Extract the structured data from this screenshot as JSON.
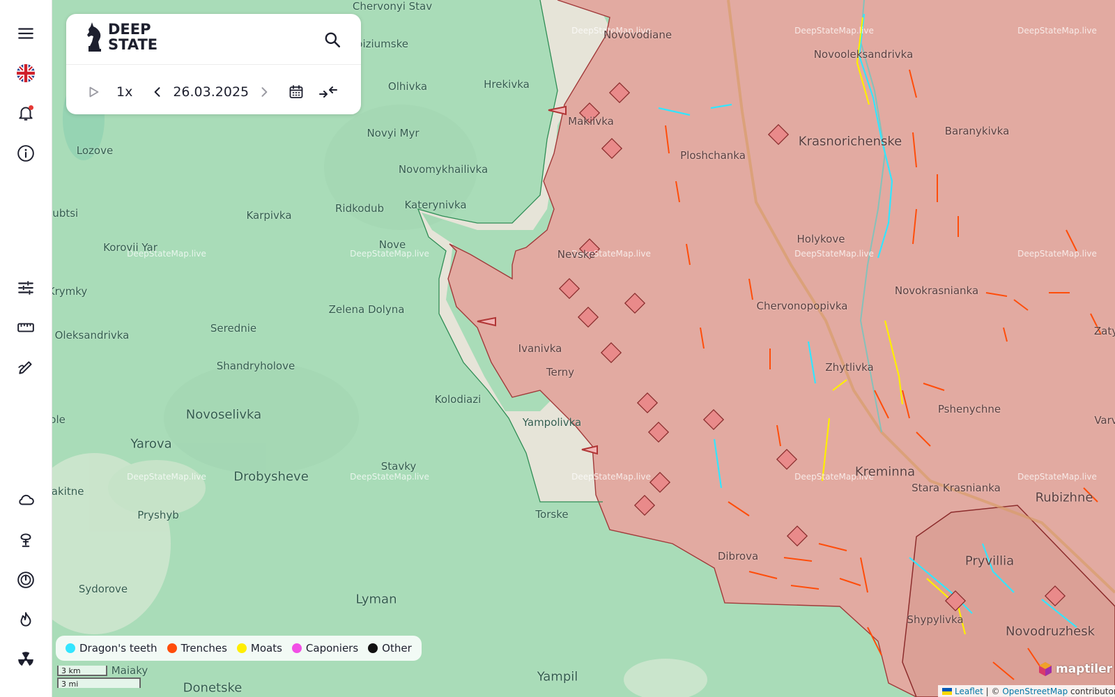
{
  "app": {
    "brand_line1": "DEEP",
    "brand_line2": "STATE",
    "watermark": "DeepStateMap.live"
  },
  "sidebar": {
    "items": [
      {
        "name": "menu",
        "icon": "menu-icon"
      },
      {
        "name": "language",
        "icon": "uk-flag-icon"
      },
      {
        "name": "notifications",
        "icon": "bell-icon"
      },
      {
        "name": "info",
        "icon": "info-icon"
      },
      {
        "name": "filters",
        "icon": "sliders-icon"
      },
      {
        "name": "ruler",
        "icon": "ruler-icon"
      },
      {
        "name": "draw",
        "icon": "draw-icon"
      },
      {
        "name": "weather",
        "icon": "cloud-icon"
      },
      {
        "name": "explosion",
        "icon": "explosion-icon"
      },
      {
        "name": "power",
        "icon": "power-plant-icon"
      },
      {
        "name": "fire",
        "icon": "fire-icon"
      },
      {
        "name": "nuclear",
        "icon": "radiation-icon"
      }
    ]
  },
  "timeline": {
    "speed": "1x",
    "date": "26.03.2025"
  },
  "legend": {
    "items": [
      {
        "label": "Dragon's teeth",
        "color": "#33e5ff"
      },
      {
        "label": "Trenches",
        "color": "#ff4d0a"
      },
      {
        "label": "Moats",
        "color": "#ffee00"
      },
      {
        "label": "Caponiers",
        "color": "#f24fe6"
      },
      {
        "label": "Other",
        "color": "#111111"
      }
    ]
  },
  "scale": {
    "metric": "3 km",
    "imperial": "3 mi"
  },
  "attribution": {
    "leaflet": "Leaflet",
    "separator": " | © ",
    "osm": "OpenStreetMap",
    "suffix": " contributors",
    "maptiler": "maptiler"
  },
  "map": {
    "colors": {
      "ukraine_controlled": "#a9dcb8",
      "occupied": "#e2aaa1",
      "gray_zone": "#ece4dc",
      "frontline": "#2f8c55",
      "occupied_border": "#a13a3a"
    },
    "places": [
      "Chervonyi Stav",
      "Novoiziumske",
      "Olhivka",
      "Hrekivka",
      "Novyi Myr",
      "Lozove",
      "Novomykhailivka",
      "Ridkodub",
      "Katerynivka",
      "Karpivka",
      "Korovii Yar",
      "Nove",
      "Zelena Dolyna",
      "Kolodiazi",
      "Serednie",
      "Shandryholove",
      "Novoselivka",
      "Oleksandrivka",
      "Yarova",
      "Drobysheve",
      "Stavky",
      "Torske",
      "Lyman",
      "Sydorove",
      "Pryshyb",
      "Yampil",
      "Donetske",
      "Maiaky",
      "Krymky",
      "Subtsi",
      "Zakitne",
      "Novovodiane",
      "Makiivka",
      "Ploshchanka",
      "Novooleksandrivka",
      "Krasnorichenske",
      "Baranykivka",
      "Holykove",
      "Nevske",
      "Novokrasnianka",
      "Chervonopopivka",
      "Ivanivka",
      "Terny",
      "Zhytlivka",
      "Yampolivka",
      "Pshenychne",
      "Kreminna",
      "Stara Krasnianka",
      "Rubizhne",
      "Dibrova",
      "Pryvillia",
      "Shypylivka",
      "Novodruzhesk",
      "Zaty",
      "Varv",
      "Vole"
    ]
  }
}
